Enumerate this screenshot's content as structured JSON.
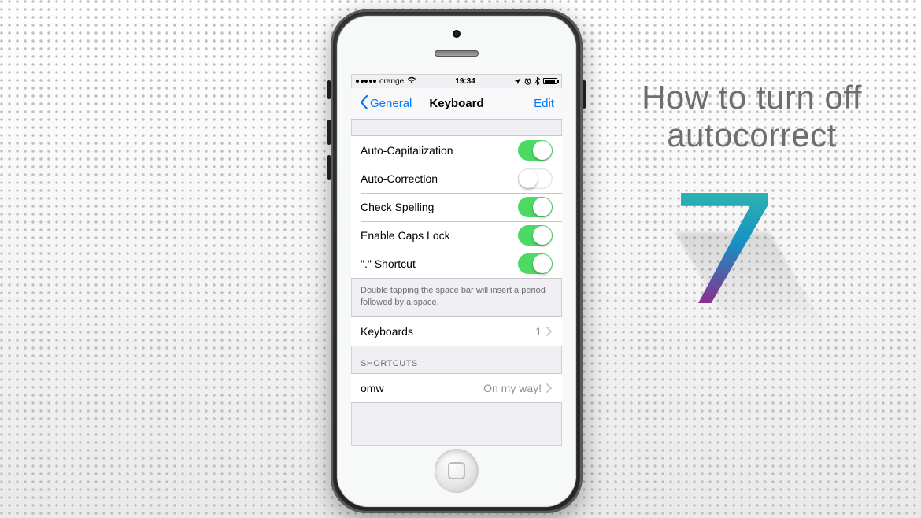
{
  "promo": {
    "line1": "How to turn off",
    "line2": "autocorrect"
  },
  "status": {
    "carrier": "orange",
    "time": "19:34"
  },
  "nav": {
    "back_label": "General",
    "title": "Keyboard",
    "edit": "Edit"
  },
  "toggles": [
    {
      "label": "Auto-Capitalization",
      "on": true,
      "slug": "auto-capitalization"
    },
    {
      "label": "Auto-Correction",
      "on": false,
      "slug": "auto-correction"
    },
    {
      "label": "Check Spelling",
      "on": true,
      "slug": "check-spelling"
    },
    {
      "label": "Enable Caps Lock",
      "on": true,
      "slug": "enable-caps-lock"
    },
    {
      "label": "\".\" Shortcut",
      "on": true,
      "slug": "period-shortcut"
    }
  ],
  "toggle_footer": "Double tapping the space bar will insert a period followed by a space.",
  "keyboards": {
    "label": "Keyboards",
    "count": "1"
  },
  "shortcuts": {
    "header": "SHORTCUTS",
    "items": [
      {
        "key": "omw",
        "value": "On my way!"
      }
    ]
  }
}
